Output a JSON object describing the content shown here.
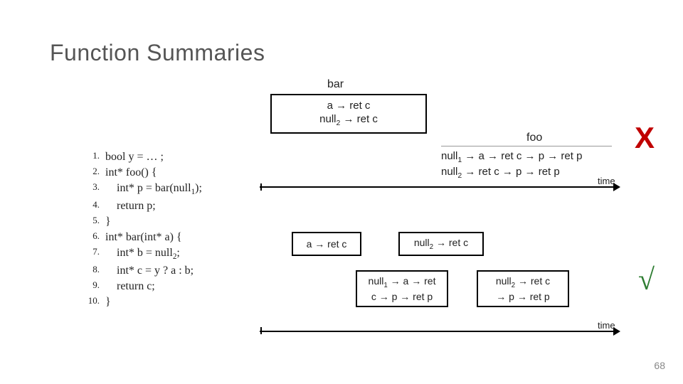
{
  "title": "Function Summaries",
  "bar_label": "bar",
  "foo_label": "foo",
  "bigbox": {
    "line1": "a → ret c",
    "line2_pre": "null",
    "line2_sub": "2",
    "line2_post": " → ret c"
  },
  "foo_rel": {
    "l1_a": "null",
    "l1_sub": "1",
    "l1_b": " → a → ret c → p → ret p",
    "l2_a": "null",
    "l2_sub": "2",
    "l2_b": " → ret c → p → ret p"
  },
  "code": {
    "1": "bool y = … ;",
    "2": "int* foo() {",
    "3_pre": "    int* p = bar(null",
    "3_sub": "1",
    "3_post": ");",
    "4": "    return p;",
    "5": "}",
    "6": "int* bar(int* a) {",
    "7_pre": "    int* b = null",
    "7_sub": "2",
    "7_post": ";",
    "8": "    int* c = y ? a : b;",
    "9": "    return c;",
    "10": "}"
  },
  "s1": "a → ret c",
  "s2": {
    "pre": "null",
    "sub": "2",
    "post": " → ret c"
  },
  "s3": {
    "l1a": "null",
    "l1s": "1",
    "l1b": " → a → ret",
    "l2": "c → p → ret p"
  },
  "s4": {
    "l1a": "null",
    "l1s": "2",
    "l1b": " → ret c",
    "l2": "→ p → ret p"
  },
  "time": "time",
  "x": "X",
  "check": "√",
  "page": "68"
}
